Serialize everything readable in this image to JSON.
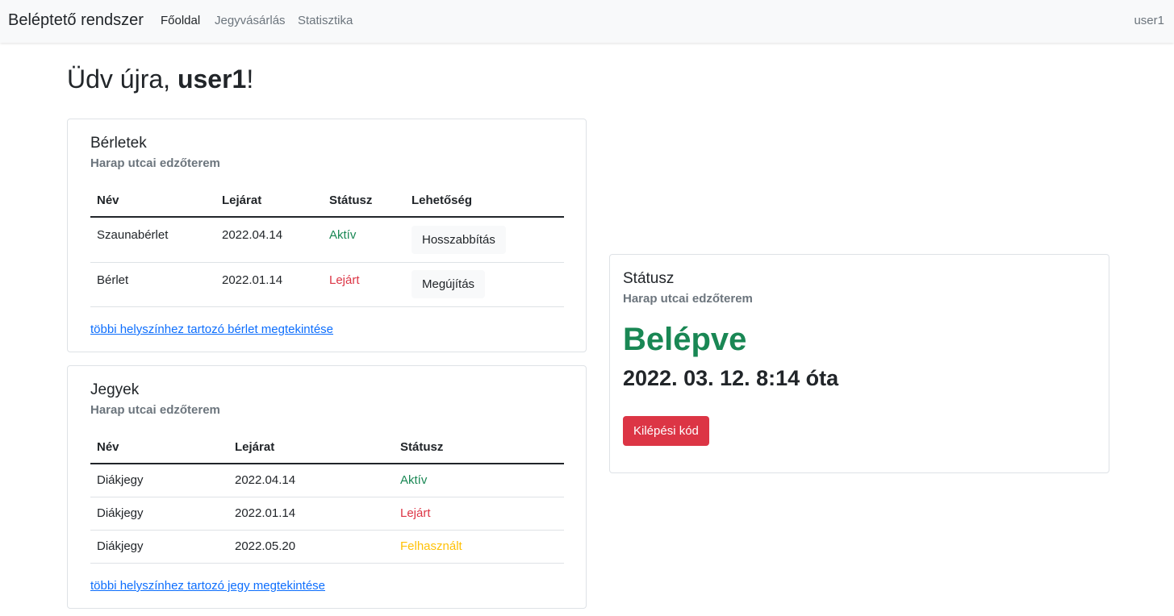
{
  "navbar": {
    "brand": "Beléptető rendszer",
    "links": [
      {
        "label": "Főoldal",
        "active": true
      },
      {
        "label": "Jegyvásárlás",
        "active": false
      },
      {
        "label": "Statisztika",
        "active": false
      }
    ],
    "user": "user1"
  },
  "welcome": {
    "prefix": "Üdv újra, ",
    "username": "user1",
    "suffix": "!"
  },
  "passes": {
    "title": "Bérletek",
    "subtitle": "Harap utcai edzőterem",
    "headers": [
      "Név",
      "Lejárat",
      "Státusz",
      "Lehetőség"
    ],
    "rows": [
      {
        "name": "Szaunabérlet",
        "expiry": "2022.04.14",
        "status": "Aktív",
        "action": "Hosszabbítás"
      },
      {
        "name": "Bérlet",
        "expiry": "2022.01.14",
        "status": "Lejárt",
        "action": "Megújítás"
      }
    ],
    "link": "többi helyszínhez tartozó bérlet megtekintése"
  },
  "tickets": {
    "title": "Jegyek",
    "subtitle": "Harap utcai edzőterem",
    "headers": [
      "Név",
      "Lejárat",
      "Státusz"
    ],
    "rows": [
      {
        "name": "Diákjegy",
        "expiry": "2022.04.14",
        "status": "Aktív"
      },
      {
        "name": "Diákjegy",
        "expiry": "2022.01.14",
        "status": "Lejárt"
      },
      {
        "name": "Diákjegy",
        "expiry": "2022.05.20",
        "status": "Felhasznált"
      }
    ],
    "link": "többi helyszínhez tartozó jegy megtekintése"
  },
  "status_card": {
    "title": "Státusz",
    "subtitle": "Harap utcai edzőterem",
    "state": "Belépve",
    "since": "2022. 03. 12. 8:14 óta",
    "exit_button": "Kilépési kód"
  },
  "colors": {
    "active": "#198754",
    "expired": "#dc3545",
    "used": "#ffc107",
    "link": "#0d6efd",
    "danger": "#dc3545"
  }
}
